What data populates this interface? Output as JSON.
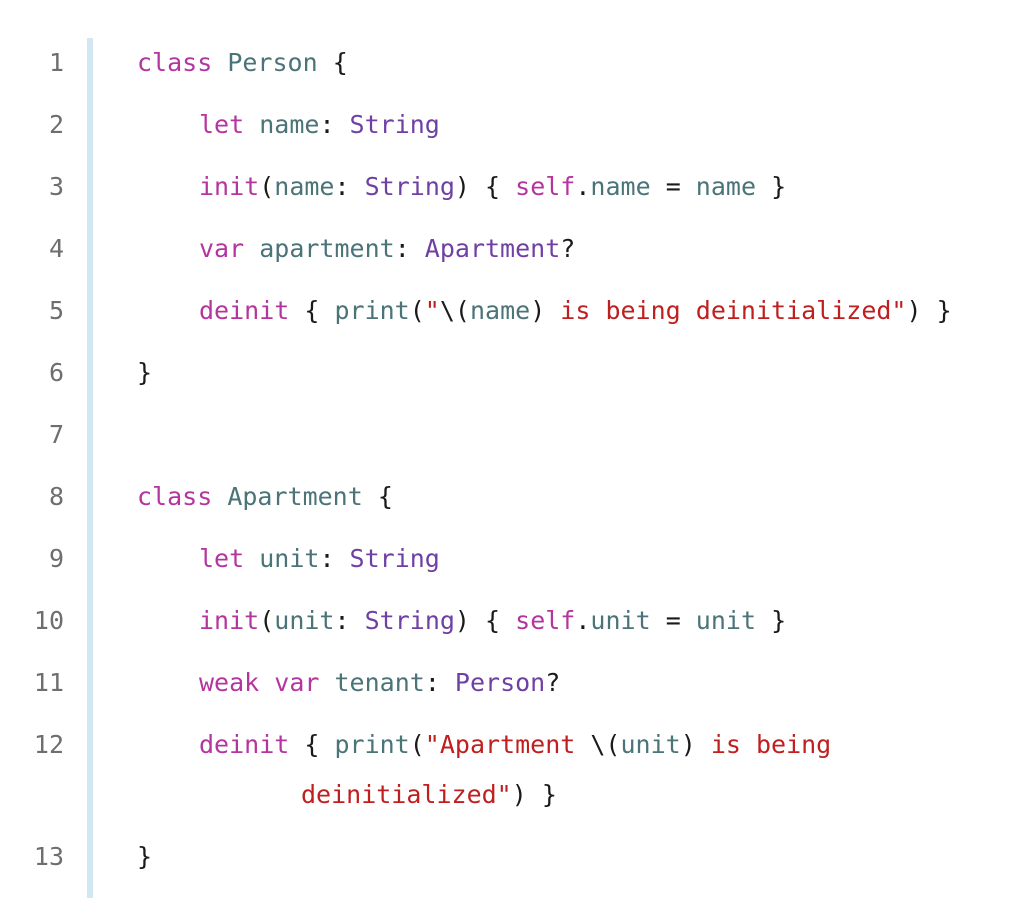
{
  "code": {
    "lines": [
      {
        "number": "1",
        "indent": 0,
        "tokens": [
          {
            "t": "class",
            "k": "keyword"
          },
          {
            "t": " ",
            "k": "plain"
          },
          {
            "t": "Person",
            "k": "ident"
          },
          {
            "t": " {",
            "k": "plain"
          }
        ]
      },
      {
        "number": "2",
        "indent": 1,
        "tokens": [
          {
            "t": "let",
            "k": "keyword"
          },
          {
            "t": " ",
            "k": "plain"
          },
          {
            "t": "name",
            "k": "ident"
          },
          {
            "t": ": ",
            "k": "plain"
          },
          {
            "t": "String",
            "k": "type"
          }
        ]
      },
      {
        "number": "3",
        "indent": 1,
        "tokens": [
          {
            "t": "init",
            "k": "keyword"
          },
          {
            "t": "(",
            "k": "plain"
          },
          {
            "t": "name",
            "k": "ident"
          },
          {
            "t": ": ",
            "k": "plain"
          },
          {
            "t": "String",
            "k": "type"
          },
          {
            "t": ") { ",
            "k": "plain"
          },
          {
            "t": "self",
            "k": "keyword"
          },
          {
            "t": ".",
            "k": "plain"
          },
          {
            "t": "name",
            "k": "ident"
          },
          {
            "t": " = ",
            "k": "plain"
          },
          {
            "t": "name",
            "k": "ident"
          },
          {
            "t": " }",
            "k": "plain"
          }
        ]
      },
      {
        "number": "4",
        "indent": 1,
        "tokens": [
          {
            "t": "var",
            "k": "keyword"
          },
          {
            "t": " ",
            "k": "plain"
          },
          {
            "t": "apartment",
            "k": "ident"
          },
          {
            "t": ": ",
            "k": "plain"
          },
          {
            "t": "Apartment",
            "k": "type"
          },
          {
            "t": "?",
            "k": "plain"
          }
        ]
      },
      {
        "number": "5",
        "indent": 1,
        "tokens": [
          {
            "t": "deinit",
            "k": "keyword"
          },
          {
            "t": " { ",
            "k": "plain"
          },
          {
            "t": "print",
            "k": "ident"
          },
          {
            "t": "(",
            "k": "plain"
          },
          {
            "t": "\"",
            "k": "string"
          },
          {
            "t": "\\(",
            "k": "plain"
          },
          {
            "t": "name",
            "k": "ident"
          },
          {
            "t": ")",
            "k": "plain"
          },
          {
            "t": " is being deinitialized\"",
            "k": "string"
          },
          {
            "t": ") }",
            "k": "plain"
          }
        ]
      },
      {
        "number": "6",
        "indent": 0,
        "tokens": [
          {
            "t": "}",
            "k": "plain"
          }
        ]
      },
      {
        "number": "7",
        "indent": 0,
        "tokens": []
      },
      {
        "number": "8",
        "indent": 0,
        "tokens": [
          {
            "t": "class",
            "k": "keyword"
          },
          {
            "t": " ",
            "k": "plain"
          },
          {
            "t": "Apartment",
            "k": "ident"
          },
          {
            "t": " {",
            "k": "plain"
          }
        ]
      },
      {
        "number": "9",
        "indent": 1,
        "tokens": [
          {
            "t": "let",
            "k": "keyword"
          },
          {
            "t": " ",
            "k": "plain"
          },
          {
            "t": "unit",
            "k": "ident"
          },
          {
            "t": ": ",
            "k": "plain"
          },
          {
            "t": "String",
            "k": "type"
          }
        ]
      },
      {
        "number": "10",
        "indent": 1,
        "tokens": [
          {
            "t": "init",
            "k": "keyword"
          },
          {
            "t": "(",
            "k": "plain"
          },
          {
            "t": "unit",
            "k": "ident"
          },
          {
            "t": ": ",
            "k": "plain"
          },
          {
            "t": "String",
            "k": "type"
          },
          {
            "t": ") { ",
            "k": "plain"
          },
          {
            "t": "self",
            "k": "keyword"
          },
          {
            "t": ".",
            "k": "plain"
          },
          {
            "t": "unit",
            "k": "ident"
          },
          {
            "t": " = ",
            "k": "plain"
          },
          {
            "t": "unit",
            "k": "ident"
          },
          {
            "t": " }",
            "k": "plain"
          }
        ]
      },
      {
        "number": "11",
        "indent": 1,
        "tokens": [
          {
            "t": "weak",
            "k": "keyword"
          },
          {
            "t": " ",
            "k": "plain"
          },
          {
            "t": "var",
            "k": "keyword"
          },
          {
            "t": " ",
            "k": "plain"
          },
          {
            "t": "tenant",
            "k": "ident"
          },
          {
            "t": ": ",
            "k": "plain"
          },
          {
            "t": "Person",
            "k": "type"
          },
          {
            "t": "?",
            "k": "plain"
          }
        ]
      },
      {
        "number": "12",
        "indent": 1,
        "tokens": [
          {
            "t": "deinit",
            "k": "keyword"
          },
          {
            "t": " { ",
            "k": "plain"
          },
          {
            "t": "print",
            "k": "ident"
          },
          {
            "t": "(",
            "k": "plain"
          },
          {
            "t": "\"Apartment ",
            "k": "string"
          },
          {
            "t": "\\(",
            "k": "plain"
          },
          {
            "t": "unit",
            "k": "ident"
          },
          {
            "t": ") ",
            "k": "plain"
          },
          {
            "t": "is being",
            "k": "string"
          }
        ]
      },
      {
        "number": "",
        "indent": 2,
        "tokens": [
          {
            "t": "deinitialized\"",
            "k": "string"
          },
          {
            "t": ") }",
            "k": "plain"
          }
        ]
      },
      {
        "number": "13",
        "indent": 0,
        "tokens": [
          {
            "t": "}",
            "k": "plain"
          }
        ]
      }
    ]
  }
}
